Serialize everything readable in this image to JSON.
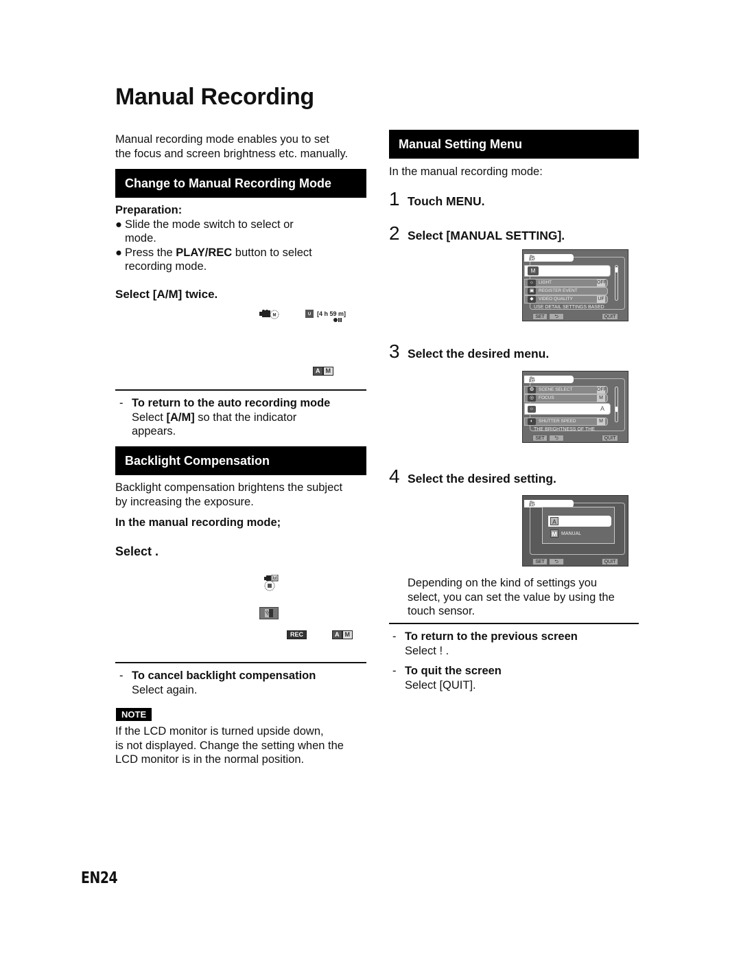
{
  "page": {
    "title": "Manual Recording",
    "page_number": "EN24"
  },
  "left": {
    "intro": [
      "Manual recording mode enables you to set",
      "the focus and screen brightness etc. manually."
    ],
    "section1": {
      "heading": "Change to Manual Recording Mode",
      "preparation_label": "Preparation:",
      "bullets": [
        {
          "line1": "Slide the mode switch to select      or",
          "line2": "mode."
        },
        {
          "line1_pre": "Press the ",
          "line1_bold": "PLAY/REC",
          "line1_post": " button to select",
          "line2": "recording mode."
        }
      ],
      "step": "Select [A/M] twice.",
      "osd": {
        "mode_icon": "camera-manual-icon",
        "remaining_time": "[4 h 59 m]",
        "quality_icon": "video-quality-icon",
        "battery_icon": "battery-icon",
        "am_button": {
          "a": "A",
          "m": "M"
        }
      },
      "tip": {
        "heading": "To return to the auto recording mode",
        "line1_pre": "Select ",
        "line1_bold": "[A/M]",
        "line1_post": " so that the      indicator",
        "line2": "appears."
      }
    },
    "section2": {
      "heading": "Backlight Compensation",
      "desc": [
        "Backlight compensation brightens the subject",
        "by increasing the exposure."
      ],
      "mode_label": "In the manual recording mode;",
      "step": "Select     .",
      "osd": {
        "mode_icon": "camera-manual-icon",
        "mode_m": "M",
        "backlight_indicator": "backlight-indicator-icon",
        "backlight_button": "backlight-button-icon",
        "rec_button": "REC",
        "am_button": {
          "a": "A",
          "m": "M"
        }
      },
      "tip": {
        "heading": "To cancel backlight compensation",
        "line1": "Select      again."
      }
    },
    "note": {
      "badge": "NOTE",
      "lines": [
        "If the LCD monitor is turned upside down,",
        "is not displayed. Change the setting when the",
        "LCD monitor is in the normal position."
      ]
    }
  },
  "right": {
    "heading": "Manual Setting Menu",
    "intro": "In the manual recording mode:",
    "steps": [
      {
        "num": "1",
        "text": "Touch  MENU."
      },
      {
        "num": "2",
        "text": "Select [MANUAL SETTING]."
      },
      {
        "num": "3",
        "text": "Select the desired menu."
      },
      {
        "num": "4",
        "text": "Select the desired setting."
      }
    ],
    "screen1": {
      "tab_icon": "camera-icon",
      "selected_icon": "M",
      "items": [
        {
          "icon": "light-icon",
          "label": "LIGHT",
          "value": "OFF"
        },
        {
          "icon": "register-event-icon",
          "label": "REGISTER EVENT",
          "value": ""
        },
        {
          "icon": "video-quality-icon",
          "label": "VIDEO QUALITY",
          "value": "UF"
        }
      ],
      "hint": "USE DETAIL SETTINGS BASED",
      "set_label": "SET",
      "quit_label": "QUIT"
    },
    "screen2": {
      "tab_icon": "camera-icon",
      "items": [
        {
          "icon": "scene-select-icon",
          "label": "SCENE SELECT",
          "value": "OFF"
        },
        {
          "icon": "focus-icon",
          "label": "FOCUS",
          "value": "M"
        },
        {
          "icon": "brightness-icon",
          "label": "",
          "value": "A",
          "selected": true
        },
        {
          "icon": "shutter-speed-icon",
          "label": "SHUTTER SPEED",
          "value": "M"
        }
      ],
      "hint": "THE BRIGHTNESS OF THE",
      "set_label": "SET",
      "quit_label": "QUIT"
    },
    "screen3": {
      "tab_icon": "camera-icon",
      "options": [
        {
          "icon": "A",
          "label": "",
          "selected": true
        },
        {
          "icon": "M",
          "label": "MANUAL",
          "selected": false
        }
      ],
      "set_label": "SET",
      "quit_label": "QUIT"
    },
    "note_text": [
      "Depending on the kind of settings you",
      "select, you can set the value by using the",
      "touch sensor."
    ],
    "tips": [
      {
        "heading": "To return to the previous screen",
        "line": "Select  ! ."
      },
      {
        "heading": "To quit the screen",
        "line": "Select [QUIT]."
      }
    ]
  }
}
